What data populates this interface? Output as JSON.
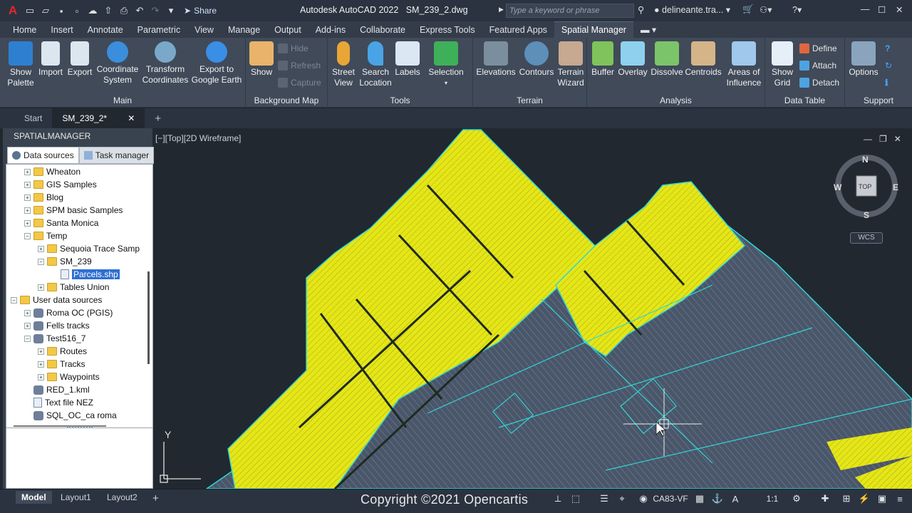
{
  "app": {
    "title": "Autodesk AutoCAD 2022",
    "file": "SM_239_2.dwg",
    "search_placeholder": "Type a keyword or phrase",
    "user": "delineante.tra...",
    "share": "Share"
  },
  "tabs": [
    "Home",
    "Insert",
    "Annotate",
    "Parametric",
    "View",
    "Manage",
    "Output",
    "Add-ins",
    "Collaborate",
    "Express Tools",
    "Featured Apps",
    "Spatial Manager"
  ],
  "active_tab": "Spatial Manager",
  "ribbon": {
    "main": {
      "title": "Main",
      "buttons": [
        "Show Palette",
        "Import",
        "Export",
        "Coordinate System",
        "Transform Coordinates",
        "Export to Google Earth"
      ]
    },
    "background_map": {
      "title": "Background Map",
      "show": "Show",
      "hide": "Hide",
      "refresh": "Refresh",
      "capture": "Capture"
    },
    "tools": {
      "title": "Tools",
      "buttons": [
        "Street View",
        "Search Location",
        "Labels",
        "Selection"
      ]
    },
    "terrain": {
      "title": "Terrain",
      "buttons": [
        "Elevations",
        "Contours",
        "Terrain Wizard"
      ]
    },
    "analysis": {
      "title": "Analysis",
      "buttons": [
        "Buffer",
        "Overlay",
        "Dissolve",
        "Centroids",
        "Areas of Influence"
      ]
    },
    "data_table": {
      "title": "Data Table",
      "show_grid": "Show Grid",
      "define": "Define",
      "attach": "Attach",
      "detach": "Detach"
    },
    "support": {
      "title": "Support",
      "options": "Options"
    }
  },
  "doc_tabs": {
    "start": "Start",
    "active": "SM_239_2*"
  },
  "palette": {
    "title": "SPATIALMANAGER",
    "tab_data": "Data sources",
    "tab_task": "Task manager",
    "tree": [
      {
        "label": "Wheaton",
        "icon": "folder"
      },
      {
        "label": "GIS Samples",
        "icon": "folder"
      },
      {
        "label": "Blog",
        "icon": "folder"
      },
      {
        "label": "SPM basic Samples",
        "icon": "folder"
      },
      {
        "label": "Santa Monica",
        "icon": "folder"
      },
      {
        "label": "Temp",
        "icon": "folder"
      },
      {
        "label": "Sequoia Trace Samp",
        "icon": "folder"
      },
      {
        "label": "SM_239",
        "icon": "folder"
      },
      {
        "label": "Parcels.shp",
        "icon": "file"
      },
      {
        "label": "Tables Union",
        "icon": "folder"
      },
      {
        "label": "User data sources",
        "icon": "folder"
      },
      {
        "label": "Roma OC (PGIS)",
        "icon": "db"
      },
      {
        "label": "Fells tracks",
        "icon": "db"
      },
      {
        "label": "Test516_7",
        "icon": "db"
      },
      {
        "label": "Routes",
        "icon": "folder"
      },
      {
        "label": "Tracks",
        "icon": "folder"
      },
      {
        "label": "Waypoints",
        "icon": "folder"
      },
      {
        "label": "RED_1.kml",
        "icon": "db"
      },
      {
        "label": "Text file NEZ",
        "icon": "file"
      },
      {
        "label": "SQL_OC_ca roma",
        "icon": "db"
      }
    ]
  },
  "viewport": {
    "label": "[−][Top][2D Wireframe]",
    "compass": {
      "n": "N",
      "s": "S",
      "e": "E",
      "w": "W",
      "top": "TOP"
    },
    "wcs": "WCS",
    "axis_y": "Y"
  },
  "statusbar": {
    "model": "Model",
    "layout1": "Layout1",
    "layout2": "Layout2",
    "copyright": "Copyright ©2021 Opencartis",
    "coord_sys": "CA83-VF",
    "scale": "1:1"
  },
  "colors": {
    "parcels_yellow": "#e5e617",
    "parcels_gray": "#4a5669",
    "outline_cyan": "#2fd6d6"
  }
}
